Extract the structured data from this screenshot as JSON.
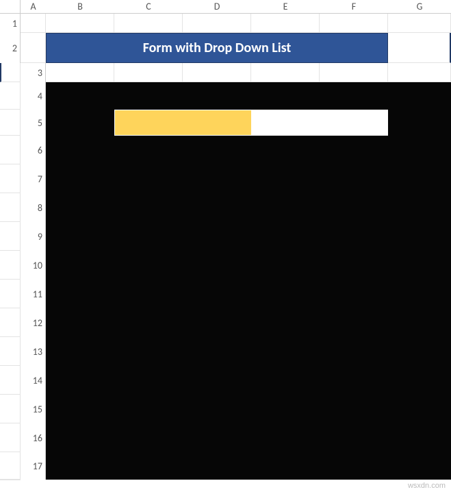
{
  "columns": [
    "A",
    "B",
    "C",
    "D",
    "E",
    "F",
    "G"
  ],
  "rows": [
    "1",
    "2",
    "3",
    "4",
    "5",
    "6",
    "7",
    "8",
    "9",
    "10",
    "11",
    "12",
    "13",
    "14",
    "15",
    "16",
    "17"
  ],
  "title": "Form with Drop Down List",
  "form": {
    "label_cell": "",
    "input_cell": ""
  },
  "watermark": "wsxdn.com"
}
